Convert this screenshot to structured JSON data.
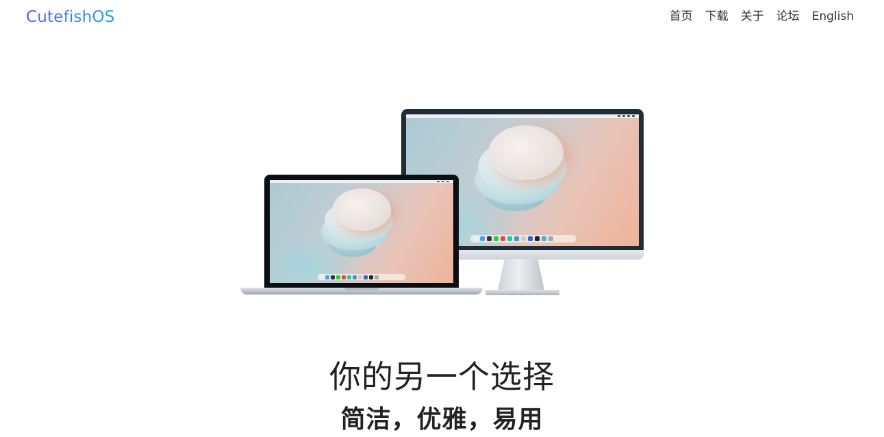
{
  "header": {
    "logo": "CutefishOS",
    "nav": [
      {
        "label": "首页"
      },
      {
        "label": "下载"
      },
      {
        "label": "关于"
      },
      {
        "label": "论坛"
      },
      {
        "label": "English"
      }
    ]
  },
  "hero": {
    "title": "你的另一个选择",
    "subtitle": "简洁，优雅，易用"
  },
  "colors": {
    "logo_gradient_start": "#5b5fd8",
    "logo_gradient_end": "#1aa7e8",
    "text": "#222222",
    "background": "#ffffff"
  }
}
